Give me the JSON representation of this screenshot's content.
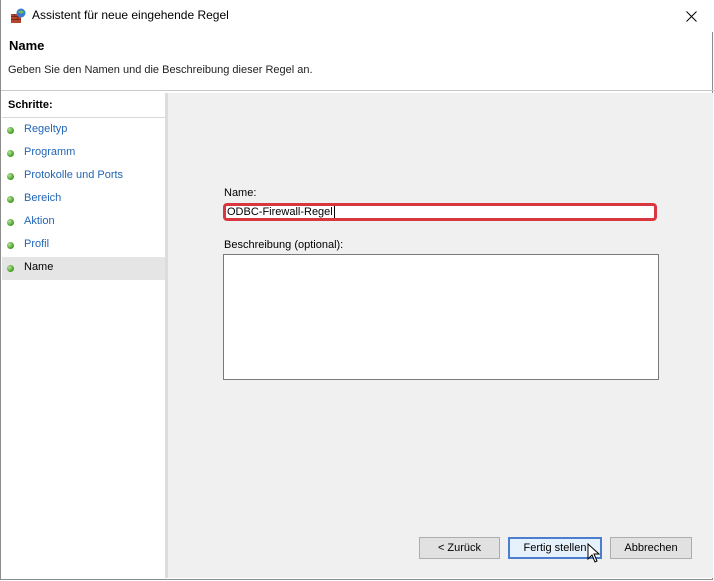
{
  "window": {
    "title": "Assistent für neue eingehende Regel",
    "close_icon": "close-icon"
  },
  "header": {
    "heading": "Name",
    "description": "Geben Sie den Namen und die Beschreibung dieser Regel an."
  },
  "sidebar": {
    "title": "Schritte:",
    "items": [
      {
        "label": "Regeltyp",
        "state": "done"
      },
      {
        "label": "Programm",
        "state": "done"
      },
      {
        "label": "Protokolle und Ports",
        "state": "done"
      },
      {
        "label": "Bereich",
        "state": "done"
      },
      {
        "label": "Aktion",
        "state": "done"
      },
      {
        "label": "Profil",
        "state": "done"
      },
      {
        "label": "Name",
        "state": "active"
      }
    ]
  },
  "form": {
    "name_label": "Name:",
    "name_value": "ODBC-Firewall-Regel",
    "description_label": "Beschreibung (optional):",
    "description_value": ""
  },
  "buttons": {
    "back": "< Zurück",
    "finish": "Fertig stellen",
    "cancel": "Abbrechen"
  },
  "colors": {
    "link": "#2266b5",
    "highlight_border": "#d9373f",
    "step_dot": "#3f9a1e",
    "focus_border": "#4a7fd0"
  }
}
